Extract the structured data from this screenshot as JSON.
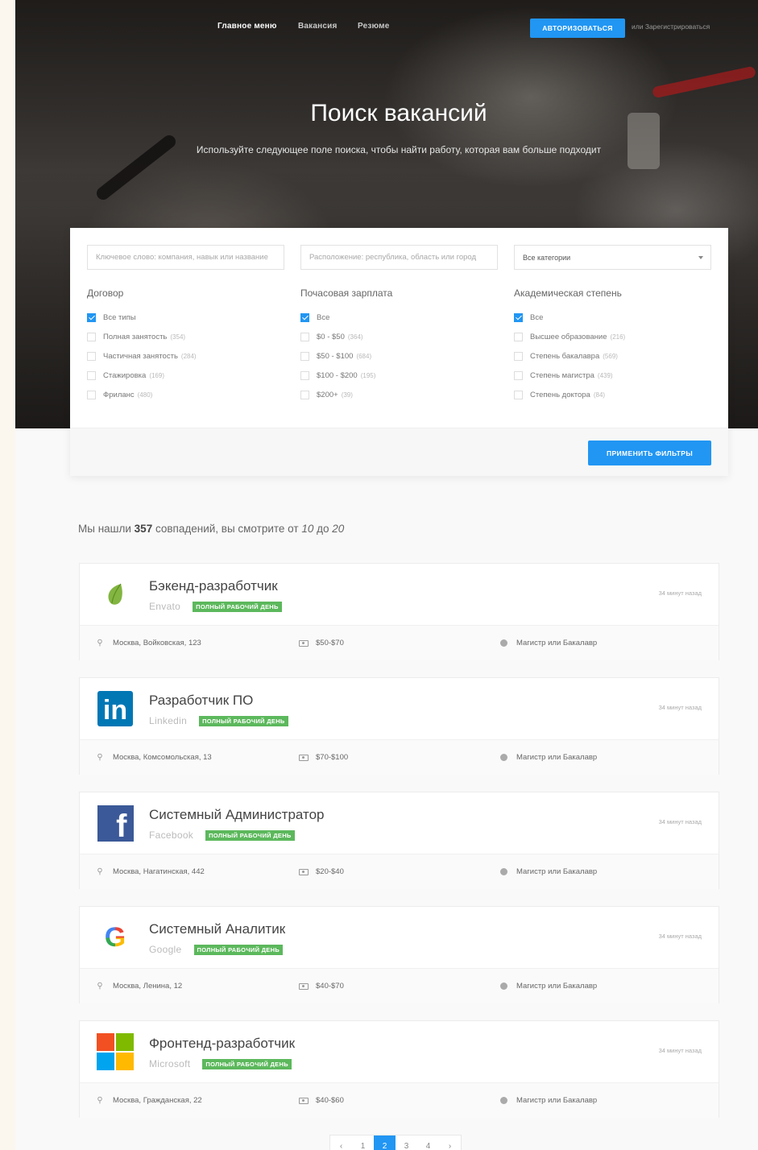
{
  "nav": {
    "items": [
      "Главное меню",
      "Вакансия",
      "Резюме"
    ],
    "login_label": "Авторизоваться",
    "register_label": "или Зарегистрироваться"
  },
  "hero": {
    "title": "Поиск вакансий",
    "subtitle": "Используйте следующее поле поиска, чтобы найти работу, которая вам больше подходит"
  },
  "search": {
    "keyword_placeholder": "Ключевое слово: компания, навык или название",
    "location_placeholder": "Расположение: республика, область или город",
    "category_value": "Все категории"
  },
  "filters": {
    "contract": {
      "title": "Договор",
      "options": [
        {
          "label": "Все типы",
          "count": "",
          "checked": true
        },
        {
          "label": "Полная занятость",
          "count": "(354)",
          "checked": false
        },
        {
          "label": "Частичная занятость",
          "count": "(284)",
          "checked": false
        },
        {
          "label": "Стажировка",
          "count": "(169)",
          "checked": false
        },
        {
          "label": "Фриланс",
          "count": "(480)",
          "checked": false
        }
      ]
    },
    "salary": {
      "title": "Почасовая зарплата",
      "options": [
        {
          "label": "Все",
          "count": "",
          "checked": true
        },
        {
          "label": "$0 - $50",
          "count": "(364)",
          "checked": false
        },
        {
          "label": "$50 - $100",
          "count": "(684)",
          "checked": false
        },
        {
          "label": "$100 - $200",
          "count": "(195)",
          "checked": false
        },
        {
          "label": "$200+",
          "count": "(39)",
          "checked": false
        }
      ]
    },
    "degree": {
      "title": "Академическая степень",
      "options": [
        {
          "label": "Все",
          "count": "",
          "checked": true
        },
        {
          "label": "Высшее образование",
          "count": "(216)",
          "checked": false
        },
        {
          "label": "Степень бакалавра",
          "count": "(569)",
          "checked": false
        },
        {
          "label": "Степень магистра",
          "count": "(439)",
          "checked": false
        },
        {
          "label": "Степень доктора",
          "count": "(84)",
          "checked": false
        }
      ]
    },
    "apply_label": "Применить фильтры"
  },
  "results": {
    "prefix": "Мы нашли ",
    "total": "357",
    "middle": " совпадений, вы смотрите от ",
    "from": "10",
    "to_word": " до ",
    "to": "20"
  },
  "jobs": [
    {
      "title": "Бэкенд-разработчик",
      "company": "Envato",
      "badge": "полный рабочий день",
      "time": "34 минут назад",
      "location": "Москва, Войковская, 123",
      "salary": "$50-$70",
      "education": "Магистр или Бакалавр",
      "logo": "envato-leaf-icon"
    },
    {
      "title": "Разработчик ПО",
      "company": "Linkedin",
      "badge": "полный рабочий день",
      "time": "34 минут назад",
      "location": "Москва, Комсомольская, 13",
      "salary": "$70-$100",
      "education": "Магистр или Бакалавр",
      "logo": "linkedin-logo-icon",
      "logo_text": "in"
    },
    {
      "title": "Системный Администратор",
      "company": "Facebook",
      "badge": "полный рабочий день",
      "time": "34 минут назад",
      "location": "Москва, Нагатинская, 442",
      "salary": "$20-$40",
      "education": "Магистр или Бакалавр",
      "logo": "facebook-logo-icon",
      "logo_text": "f"
    },
    {
      "title": "Системный Аналитик",
      "company": "Google",
      "badge": "полный рабочий день",
      "time": "34 минут назад",
      "location": "Москва, Ленина, 12",
      "salary": "$40-$70",
      "education": "Магистр или Бакалавр",
      "logo": "google-logo-icon",
      "logo_text": "G"
    },
    {
      "title": "Фронтенд-разработчик",
      "company": "Microsoft",
      "badge": "полный рабочий день",
      "time": "34 минут назад",
      "location": "Москва, Гражданская, 22",
      "salary": "$40-$60",
      "education": "Магистр или Бакалавр",
      "logo": "microsoft-logo-icon"
    }
  ],
  "pagination": {
    "pages": [
      "1",
      "2",
      "3",
      "4"
    ],
    "current": "2"
  },
  "colors": {
    "accent": "#2196f3",
    "badge": "#5cb85c",
    "linkedin": "#0077b5",
    "facebook": "#3b5998"
  }
}
